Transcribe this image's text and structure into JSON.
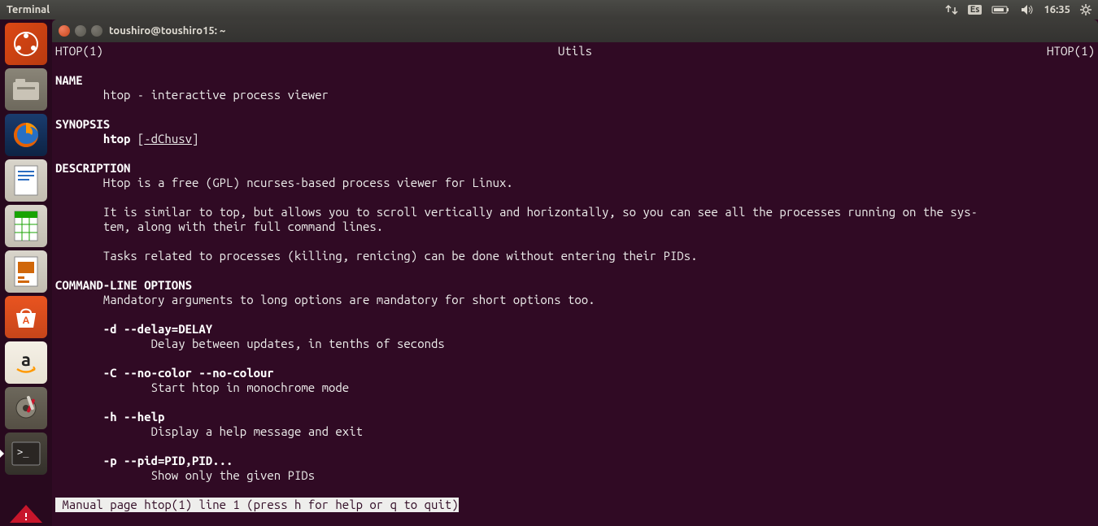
{
  "menubar": {
    "app_label": "Terminal",
    "kbd_layout": "Es",
    "clock": "16:35"
  },
  "launcher": {
    "items": [
      {
        "name": "dash-icon"
      },
      {
        "name": "files-icon"
      },
      {
        "name": "firefox-icon"
      },
      {
        "name": "writer-icon"
      },
      {
        "name": "calc-icon"
      },
      {
        "name": "impress-icon"
      },
      {
        "name": "software-center-icon"
      },
      {
        "name": "amazon-icon"
      },
      {
        "name": "settings-icon"
      },
      {
        "name": "terminal-icon"
      }
    ]
  },
  "window": {
    "title": "toushiro@toushiro15: ~"
  },
  "man": {
    "header_left": "HTOP(1)",
    "header_center": "Utils",
    "header_right": "HTOP(1)",
    "sections": {
      "name_h": "NAME",
      "name_body": "       htop - interactive process viewer",
      "syn_h": "SYNOPSIS",
      "syn_cmd": "htop",
      "syn_opts": "-dChusv",
      "desc_h": "DESCRIPTION",
      "desc_l1": "       Htop is a free (GPL) ncurses-based process viewer for Linux.",
      "desc_l2a": "       It is similar to top, but allows you to scroll vertically and horizontally, so you can see all the processes running on the sys-",
      "desc_l2b": "       tem, along with their full command lines.",
      "desc_l3": "       Tasks related to processes (killing, renicing) can be done without entering their PIDs.",
      "clo_h": "COMMAND-LINE OPTIONS",
      "clo_intro": "       Mandatory arguments to long options are mandatory for short options too.",
      "opt1_flag": "       -d --delay=DELAY",
      "opt1_desc": "              Delay between updates, in tenths of seconds",
      "opt2_flag": "       -C --no-color --no-colour",
      "opt2_desc": "              Start htop in monochrome mode",
      "opt3_flag": "       -h --help",
      "opt3_desc": "              Display a help message and exit",
      "opt4_flag": "       -p --pid=PID,PID...",
      "opt4_desc": "              Show only the given PIDs"
    },
    "status": " Manual page htop(1) line 1 (press h for help or q to quit)"
  }
}
